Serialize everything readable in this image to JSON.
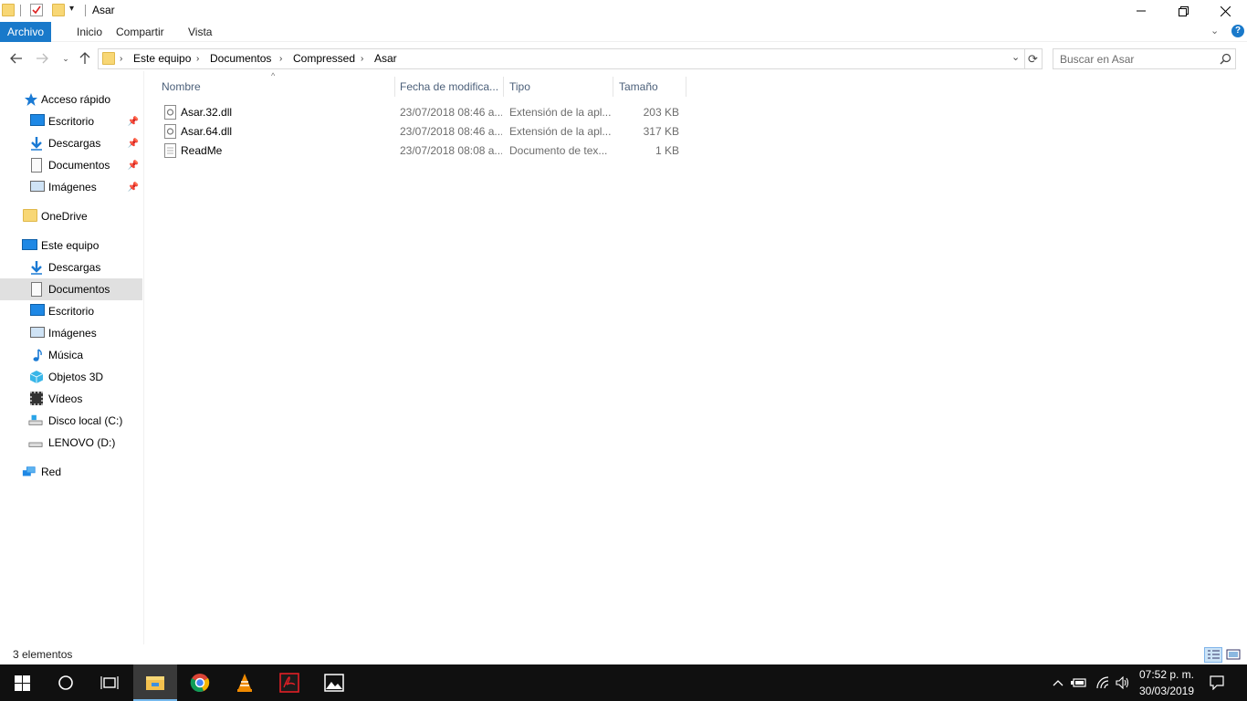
{
  "window": {
    "title": "Asar"
  },
  "ribbon": {
    "tabs": [
      "Archivo",
      "Inicio",
      "Compartir",
      "Vista"
    ]
  },
  "address": {
    "crumbs": [
      "Este equipo",
      "Documentos",
      "Compressed",
      "Asar"
    ]
  },
  "search": {
    "placeholder": "Buscar en Asar"
  },
  "nav": {
    "quick_access": "Acceso rápido",
    "quick_items": [
      "Escritorio",
      "Descargas",
      "Documentos",
      "Imágenes"
    ],
    "onedrive": "OneDrive",
    "this_pc": "Este equipo",
    "pc_items": [
      "Descargas",
      "Documentos",
      "Escritorio",
      "Imágenes",
      "Música",
      "Objetos 3D",
      "Vídeos",
      "Disco local (C:)",
      "LENOVO (D:)"
    ],
    "network": "Red",
    "selected": "Documentos"
  },
  "columns": [
    "Nombre",
    "Fecha de modifica...",
    "Tipo",
    "Tamaño"
  ],
  "files": [
    {
      "name": "Asar.32.dll",
      "date": "23/07/2018 08:46 a...",
      "type": "Extensión de la apl...",
      "size": "203 KB"
    },
    {
      "name": "Asar.64.dll",
      "date": "23/07/2018 08:46 a...",
      "type": "Extensión de la apl...",
      "size": "317 KB"
    },
    {
      "name": "ReadMe",
      "date": "23/07/2018 08:08 a...",
      "type": "Documento de tex...",
      "size": "1 KB"
    }
  ],
  "status": {
    "count": "3 elementos"
  },
  "taskbar": {
    "time": "07:52 p. m.",
    "date": "30/03/2019"
  },
  "colors": {
    "accent": "#1979ca",
    "taskbar": "#101010",
    "selection": "#e0e0e0"
  }
}
